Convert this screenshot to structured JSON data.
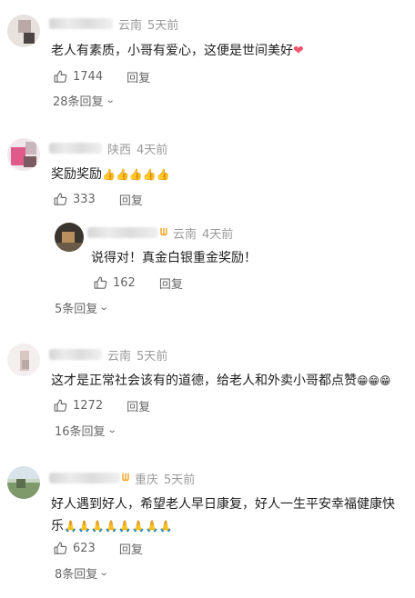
{
  "comments": [
    {
      "region": "云南",
      "time": "5天前",
      "text": "老人有素质，小哥有爱心，这便是世间美好",
      "emoji": "❤",
      "likes": "1744",
      "reply": "回复",
      "more": "28条回复"
    },
    {
      "region": "陕西",
      "time": "4天前",
      "text": "奖励奖励",
      "emoji": "👍👍👍👍👍",
      "likes": "333",
      "reply": "回复",
      "more": "5条回复",
      "sub_reply": {
        "region": "云南",
        "time": "4天前",
        "text": "说得对！真金白银重金奖励！",
        "likes": "162",
        "reply": "回复"
      }
    },
    {
      "region": "云南",
      "time": "5天前",
      "text": "这才是正常社会该有的道德，给老人和外卖小哥都点赞",
      "emoji": "😁😁😁",
      "likes": "1272",
      "reply": "回复",
      "more": "16条回复"
    },
    {
      "region": "重庆",
      "time": "5天前",
      "text_line1": "好人遇到好人，希望老人早日康复，好人一生平安幸福健康快",
      "text_line2": "乐",
      "emoji": "🙏🙏🙏🙏🙏🙏🙏🙏",
      "likes": "623",
      "reply": "回复",
      "more": "8条回复"
    }
  ],
  "icons": {
    "like": "thumbs-up-icon",
    "chevron": "chevron-down-icon",
    "vip": "vip-badge-icon"
  },
  "colors": {
    "meta": "#9a9a9a",
    "action": "#666666",
    "heart": "#f0566e",
    "vip": "#f0a21a"
  }
}
